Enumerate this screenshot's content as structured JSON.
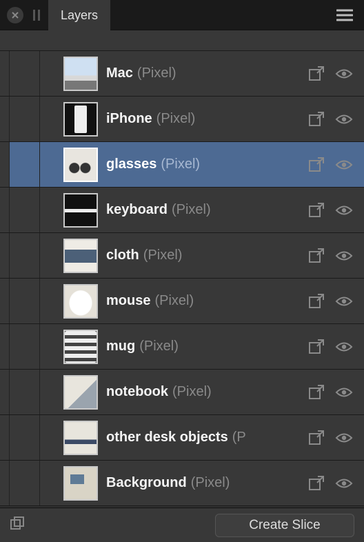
{
  "panel": {
    "tab_title": "Layers"
  },
  "layers": [
    {
      "name": "Mac",
      "type": "(Pixel)",
      "selected": false,
      "thumb": "tg-mac"
    },
    {
      "name": "iPhone",
      "type": "(Pixel)",
      "selected": false,
      "thumb": "tg-iphone"
    },
    {
      "name": "glasses",
      "type": "(Pixel)",
      "selected": true,
      "thumb": "tg-glasses"
    },
    {
      "name": "keyboard",
      "type": "(Pixel)",
      "selected": false,
      "thumb": "tg-keyboard"
    },
    {
      "name": "cloth",
      "type": "(Pixel)",
      "selected": false,
      "thumb": "tg-cloth"
    },
    {
      "name": "mouse",
      "type": "(Pixel)",
      "selected": false,
      "thumb": "tg-mouse"
    },
    {
      "name": "mug",
      "type": "(Pixel)",
      "selected": false,
      "thumb": "tg-mug"
    },
    {
      "name": "notebook",
      "type": "(Pixel)",
      "selected": false,
      "thumb": "tg-notebook"
    },
    {
      "name": "other desk objects",
      "type": "(Pixel)",
      "selected": false,
      "thumb": "tg-other",
      "truncated": true
    },
    {
      "name": "Background",
      "type": "(Pixel)",
      "selected": false,
      "thumb": "tg-bg"
    }
  ],
  "footer": {
    "create_slice_label": "Create Slice"
  },
  "colors": {
    "selected_row": "#4d6a93"
  },
  "icon_stroke": "#8a8a8a"
}
